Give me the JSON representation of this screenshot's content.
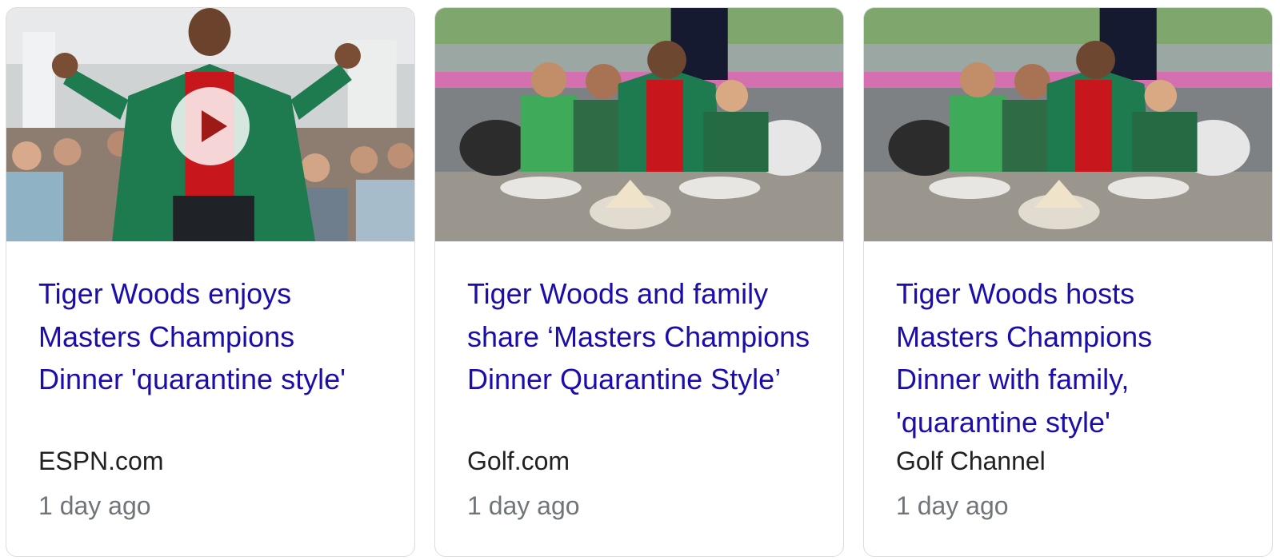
{
  "cards": [
    {
      "title": "Tiger Woods enjoys Masters Champions Dinner 'quarantine style'",
      "source": "ESPN.com",
      "time": "1 day ago",
      "thumbnail": "golfer-green-jacket-celebrating",
      "has_video": true,
      "play_icon": "play-icon"
    },
    {
      "title": "Tiger Woods and family share ‘Masters Champions Dinner Quarantine Style’",
      "source": "Golf.com",
      "time": "1 day ago",
      "thumbnail": "family-at-dinner-table",
      "has_video": false
    },
    {
      "title": "Tiger Woods hosts Masters Champions Dinner with family, 'quarantine style'",
      "source": "Golf Channel",
      "time": "1 day ago",
      "thumbnail": "family-at-dinner-table",
      "has_video": false
    }
  ],
  "colors": {
    "title_link": "#1a0dab",
    "source_text": "#202124",
    "time_text": "#70757a",
    "card_border": "#dadce0",
    "jacket_green": "#1e7a4f",
    "shirt_red": "#c8161d"
  }
}
